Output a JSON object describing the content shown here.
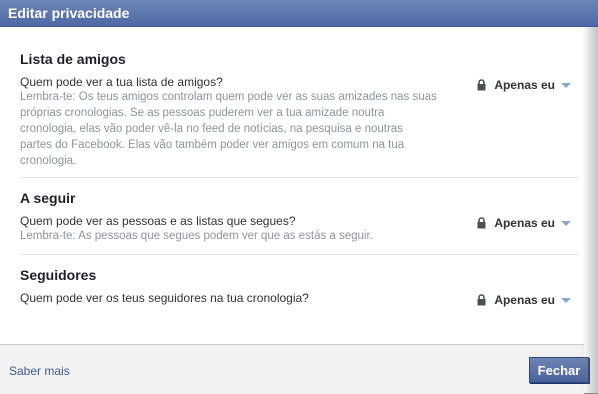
{
  "dialog": {
    "title": "Editar privacidade"
  },
  "sections": [
    {
      "heading": "Lista de amigos",
      "question": "Quem pode ver a tua lista de amigos?",
      "note": "Lembra-te: Os teus amigos controlam quem pode ver as suas amizades nas suas próprias cronologias. Se as pessoas puderem ver a tua amizade noutra cronologia, elas vão poder vê-la no feed de notícias, na pesquisa e noutras partes do Facebook. Elas vão também poder ver amigos em comum na tua cronologia.",
      "audience": "Apenas eu"
    },
    {
      "heading": "A seguir",
      "question": "Quem pode ver as pessoas e as listas que segues?",
      "note": "Lembra-te: As pessoas que segues podem ver que as estás a seguir.",
      "audience": "Apenas eu"
    },
    {
      "heading": "Seguidores",
      "question": "Quem pode ver os teus seguidores na tua cronologia?",
      "note": "",
      "audience": "Apenas eu"
    }
  ],
  "footer": {
    "learn_more": "Saber mais",
    "close_label": "Fechar"
  },
  "colors": {
    "titlebar": "#4e6aa6",
    "link": "#3b5998",
    "note": "#8d949e"
  },
  "icons": {
    "audience": "lock-icon",
    "dropdown": "chevron-down-icon"
  }
}
